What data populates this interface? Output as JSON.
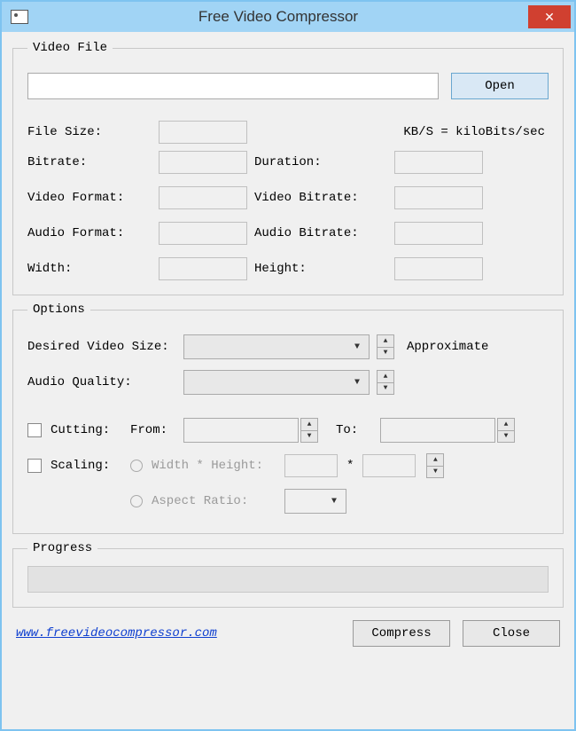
{
  "window": {
    "title": "Free Video Compressor"
  },
  "videoFile": {
    "legend": "Video File",
    "path": "",
    "openLabel": "Open",
    "fileSizeLabel": "File Size:",
    "fileSizeValue": "",
    "kbNote": "KB/S = kiloBits/sec",
    "bitrateLabel": "Bitrate:",
    "bitrateValue": "",
    "durationLabel": "Duration:",
    "durationValue": "",
    "videoFormatLabel": "Video Format:",
    "videoFormatValue": "",
    "videoBitrateLabel": "Video Bitrate:",
    "videoBitrateValue": "",
    "audioFormatLabel": "Audio Format:",
    "audioFormatValue": "",
    "audioBitrateLabel": "Audio Bitrate:",
    "audioBitrateValue": "",
    "widthLabel": "Width:",
    "widthValue": "",
    "heightLabel": "Height:",
    "heightValue": ""
  },
  "options": {
    "legend": "Options",
    "desiredSizeLabel": "Desired Video Size:",
    "desiredSizeValue": "",
    "approximateLabel": "Approximate",
    "audioQualityLabel": "Audio Quality:",
    "audioQualityValue": "",
    "cuttingLabel": "Cutting:",
    "fromLabel": "From:",
    "fromValue": "",
    "toLabel": "To:",
    "toValue": "",
    "scalingLabel": "Scaling:",
    "whLabel": "Width * Height:",
    "whWidth": "",
    "whStar": "*",
    "whHeight": "",
    "aspectLabel": "Aspect Ratio:",
    "aspectValue": ""
  },
  "progress": {
    "legend": "Progress"
  },
  "footer": {
    "link": "www.freevideocompressor.com",
    "compressLabel": "Compress",
    "closeLabel": "Close"
  }
}
